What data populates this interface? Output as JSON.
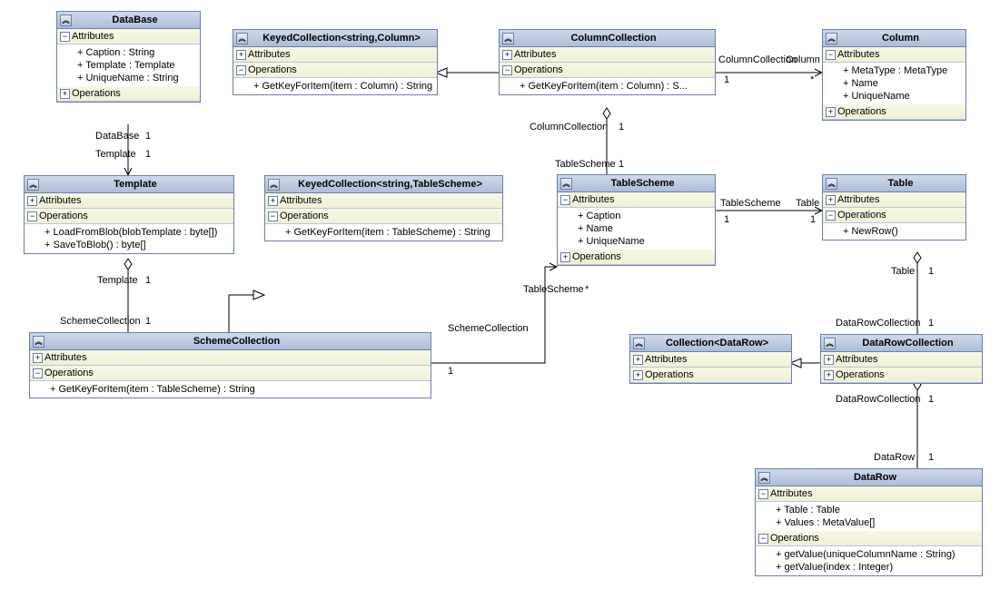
{
  "sect": {
    "attr": "Attributes",
    "ops": "Operations"
  },
  "plus": "+",
  "minus": "−",
  "classes": {
    "database": {
      "name": "DataBase",
      "attrs": [
        "+ Caption : String",
        "+ Template : Template",
        "+ UniqueName : String"
      ],
      "ops": []
    },
    "keyedCol": {
      "name": "KeyedCollection<string,Column>",
      "attrs": [],
      "ops": [
        "+ GetKeyForItem(item : Column) : String"
      ]
    },
    "colCollection": {
      "name": "ColumnCollection",
      "attrs": [],
      "ops": [
        "+ GetKeyForItem(item : Column) : S..."
      ]
    },
    "column": {
      "name": "Column",
      "attrs": [
        "+ MetaType : MetaType",
        "+ Name",
        "+ UniqueName"
      ],
      "ops": []
    },
    "template": {
      "name": "Template",
      "attrs": [],
      "ops": [
        "+ LoadFromBlob(blobTemplate : byte[])",
        "+ SaveToBlob() : byte[]"
      ]
    },
    "keyedTS": {
      "name": "KeyedCollection<string,TableScheme>",
      "attrs": [],
      "ops": [
        "+ GetKeyForItem(item : TableScheme) : String"
      ]
    },
    "tableScheme": {
      "name": "TableScheme",
      "attrs": [
        "+ Caption",
        "+ Name",
        "+ UniqueName"
      ],
      "ops": []
    },
    "table": {
      "name": "Table",
      "attrs": [],
      "ops": [
        "+ NewRow()"
      ]
    },
    "schemeCol": {
      "name": "SchemeCollection",
      "attrs": [],
      "ops": [
        "+ GetKeyForItem(item : TableScheme) : String"
      ]
    },
    "collDR": {
      "name": "Collection<DataRow>",
      "attrs": [],
      "ops": []
    },
    "dataRowCol": {
      "name": "DataRowCollection",
      "attrs": [],
      "ops": []
    },
    "dataRow": {
      "name": "DataRow",
      "attrs": [
        "+ Table : Table",
        "+ Values : MetaValue[]"
      ],
      "ops": [
        "+ getValue(uniqueColumnName : String)",
        "+ getValue(index : Integer)"
      ]
    }
  },
  "labels": {
    "database": "DataBase",
    "template": "Template",
    "schemeCol": "SchemeCollection",
    "tableScheme": "TableScheme",
    "columnCol": "ColumnCollection",
    "column": "Column",
    "table": "Table",
    "dataRowCol": "DataRowCollection",
    "dataRow": "DataRow",
    "one": "1",
    "star": "*"
  }
}
